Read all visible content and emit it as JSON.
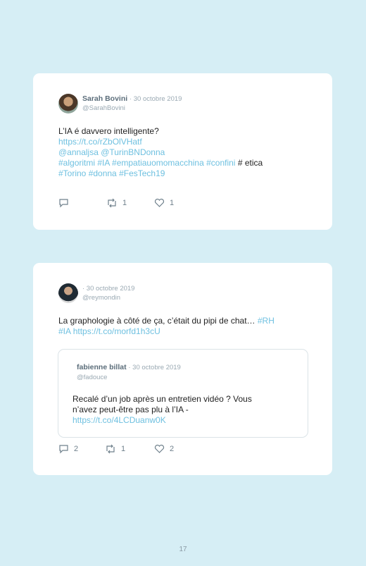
{
  "tweet1": {
    "author_name": "Sarah Bovini",
    "date": "· 30 octobre 2019",
    "handle": "@SarahBovini",
    "line1": "L’IA é davvero intelligente?",
    "link1": "https://t.co/rZbOlVHatf",
    "mentions": "@annaljsa @TurinBNDonna",
    "hashtags_a": "#algoritmi #IA #empatiauomomacchina #confini",
    "plain": " # etica",
    "hashtags_b": "#Torino #donna #FesTech19",
    "reply_count": "",
    "retweet_count": "1",
    "like_count": "1"
  },
  "tweet2": {
    "date": "· 30 octobre 2019",
    "handle": "@reymondin",
    "text_plain": "La graphologie à côté de ça, c’était du pipi de chat… ",
    "text_tag1": "#RH",
    "text_tag2": "#IA",
    "text_link": " https://t.co/morfd1h3cU",
    "reply_count": "2",
    "retweet_count": "1",
    "like_count": "2",
    "quote": {
      "author_name": "fabienne billat",
      "date": "· 30 octobre 2019",
      "handle": "@fadouce",
      "line1": "Recalé d’un job après un entretien vidéo ? Vous",
      "line2": "n’avez peut-être pas plu à l’IA -",
      "link": "https://t.co/4LCDuanw0K"
    }
  },
  "page_number": "17"
}
